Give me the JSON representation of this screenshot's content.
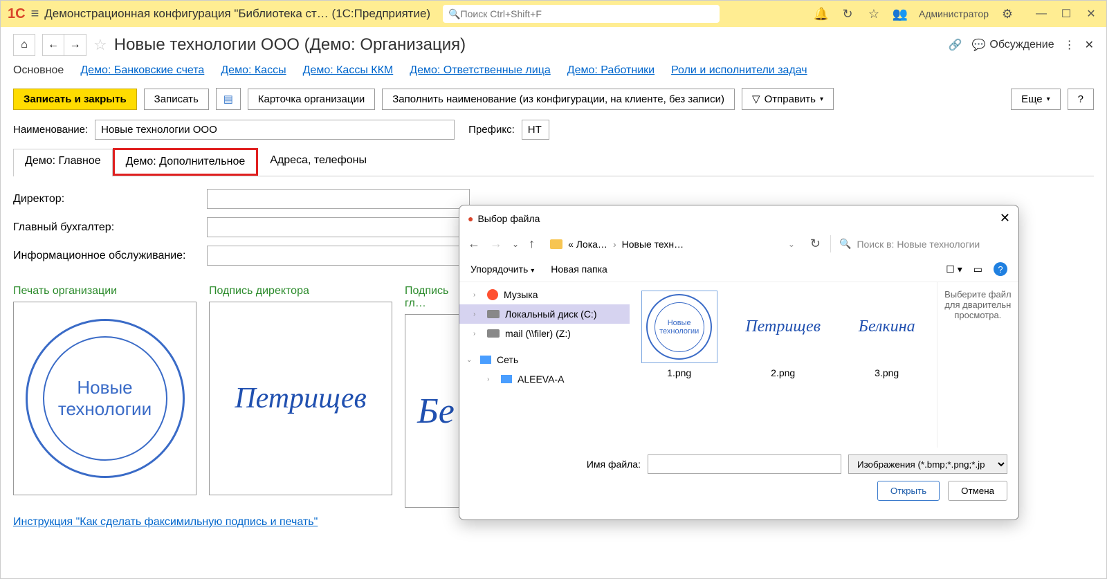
{
  "titlebar": {
    "app_title": "Демонстрационная конфигурация \"Библиотека ст…   (1С:Предприятие)",
    "search_placeholder": "Поиск Ctrl+Shift+F",
    "user": "Администратор"
  },
  "page": {
    "title": "Новые технологии ООО (Демо: Организация)",
    "discuss": "Обсуждение"
  },
  "nav": {
    "main": "Основное",
    "links": [
      "Демо: Банковские счета",
      "Демо: Кассы",
      "Демо: Кассы ККМ",
      "Демо: Ответственные лица",
      "Демо: Работники",
      "Роли и исполнители задач"
    ]
  },
  "toolbar": {
    "save_close": "Записать и закрыть",
    "save": "Записать",
    "card": "Карточка организации",
    "fill_name": "Заполнить наименование (из конфигурации, на клиенте, без записи)",
    "send": "Отправить",
    "more": "Еще",
    "help": "?"
  },
  "form": {
    "name_label": "Наименование:",
    "name_value": "Новые технологии ООО",
    "prefix_label": "Префикс:",
    "prefix_value": "НТ"
  },
  "tabs": [
    "Демо: Главное",
    "Демо: Дополнительное",
    "Адреса, телефоны"
  ],
  "fields": {
    "director": "Директор:",
    "accountant": "Главный бухгалтер:",
    "infoservice": "Информационное обслуживание:"
  },
  "images": {
    "stamp_label": "Печать организации",
    "sig1_label": "Подпись директора",
    "sig2_label": "Подпись гл…",
    "stamp_line1": "Новые",
    "stamp_line2": "технологии",
    "sig1_text": "Петрищев",
    "sig2_text": "Бе"
  },
  "instruction": "Инструкция \"Как сделать факсимильную подпись и печать\"",
  "dialog": {
    "title": "Выбор файла",
    "crumb1": "« Лока…",
    "crumb2": "Новые техн…",
    "search_placeholder": "Поиск в: Новые технологии",
    "organize": "Упорядочить",
    "new_folder": "Новая папка",
    "tree": {
      "music": "Музыка",
      "localdisk": "Локальный диск (C:)",
      "mail": "mail (\\\\filer) (Z:)",
      "network": "Сеть",
      "host": "ALEEVA-A"
    },
    "files": [
      "1.png",
      "2.png",
      "3.png"
    ],
    "file_sig1": "Петрищев",
    "file_sig2": "Белкина",
    "preview": "Выберите файл для дварительн просмотра.",
    "filename_label": "Имя файла:",
    "filter": "Изображения (*.bmp;*.png;*.jp",
    "open": "Открыть",
    "cancel": "Отмена"
  }
}
